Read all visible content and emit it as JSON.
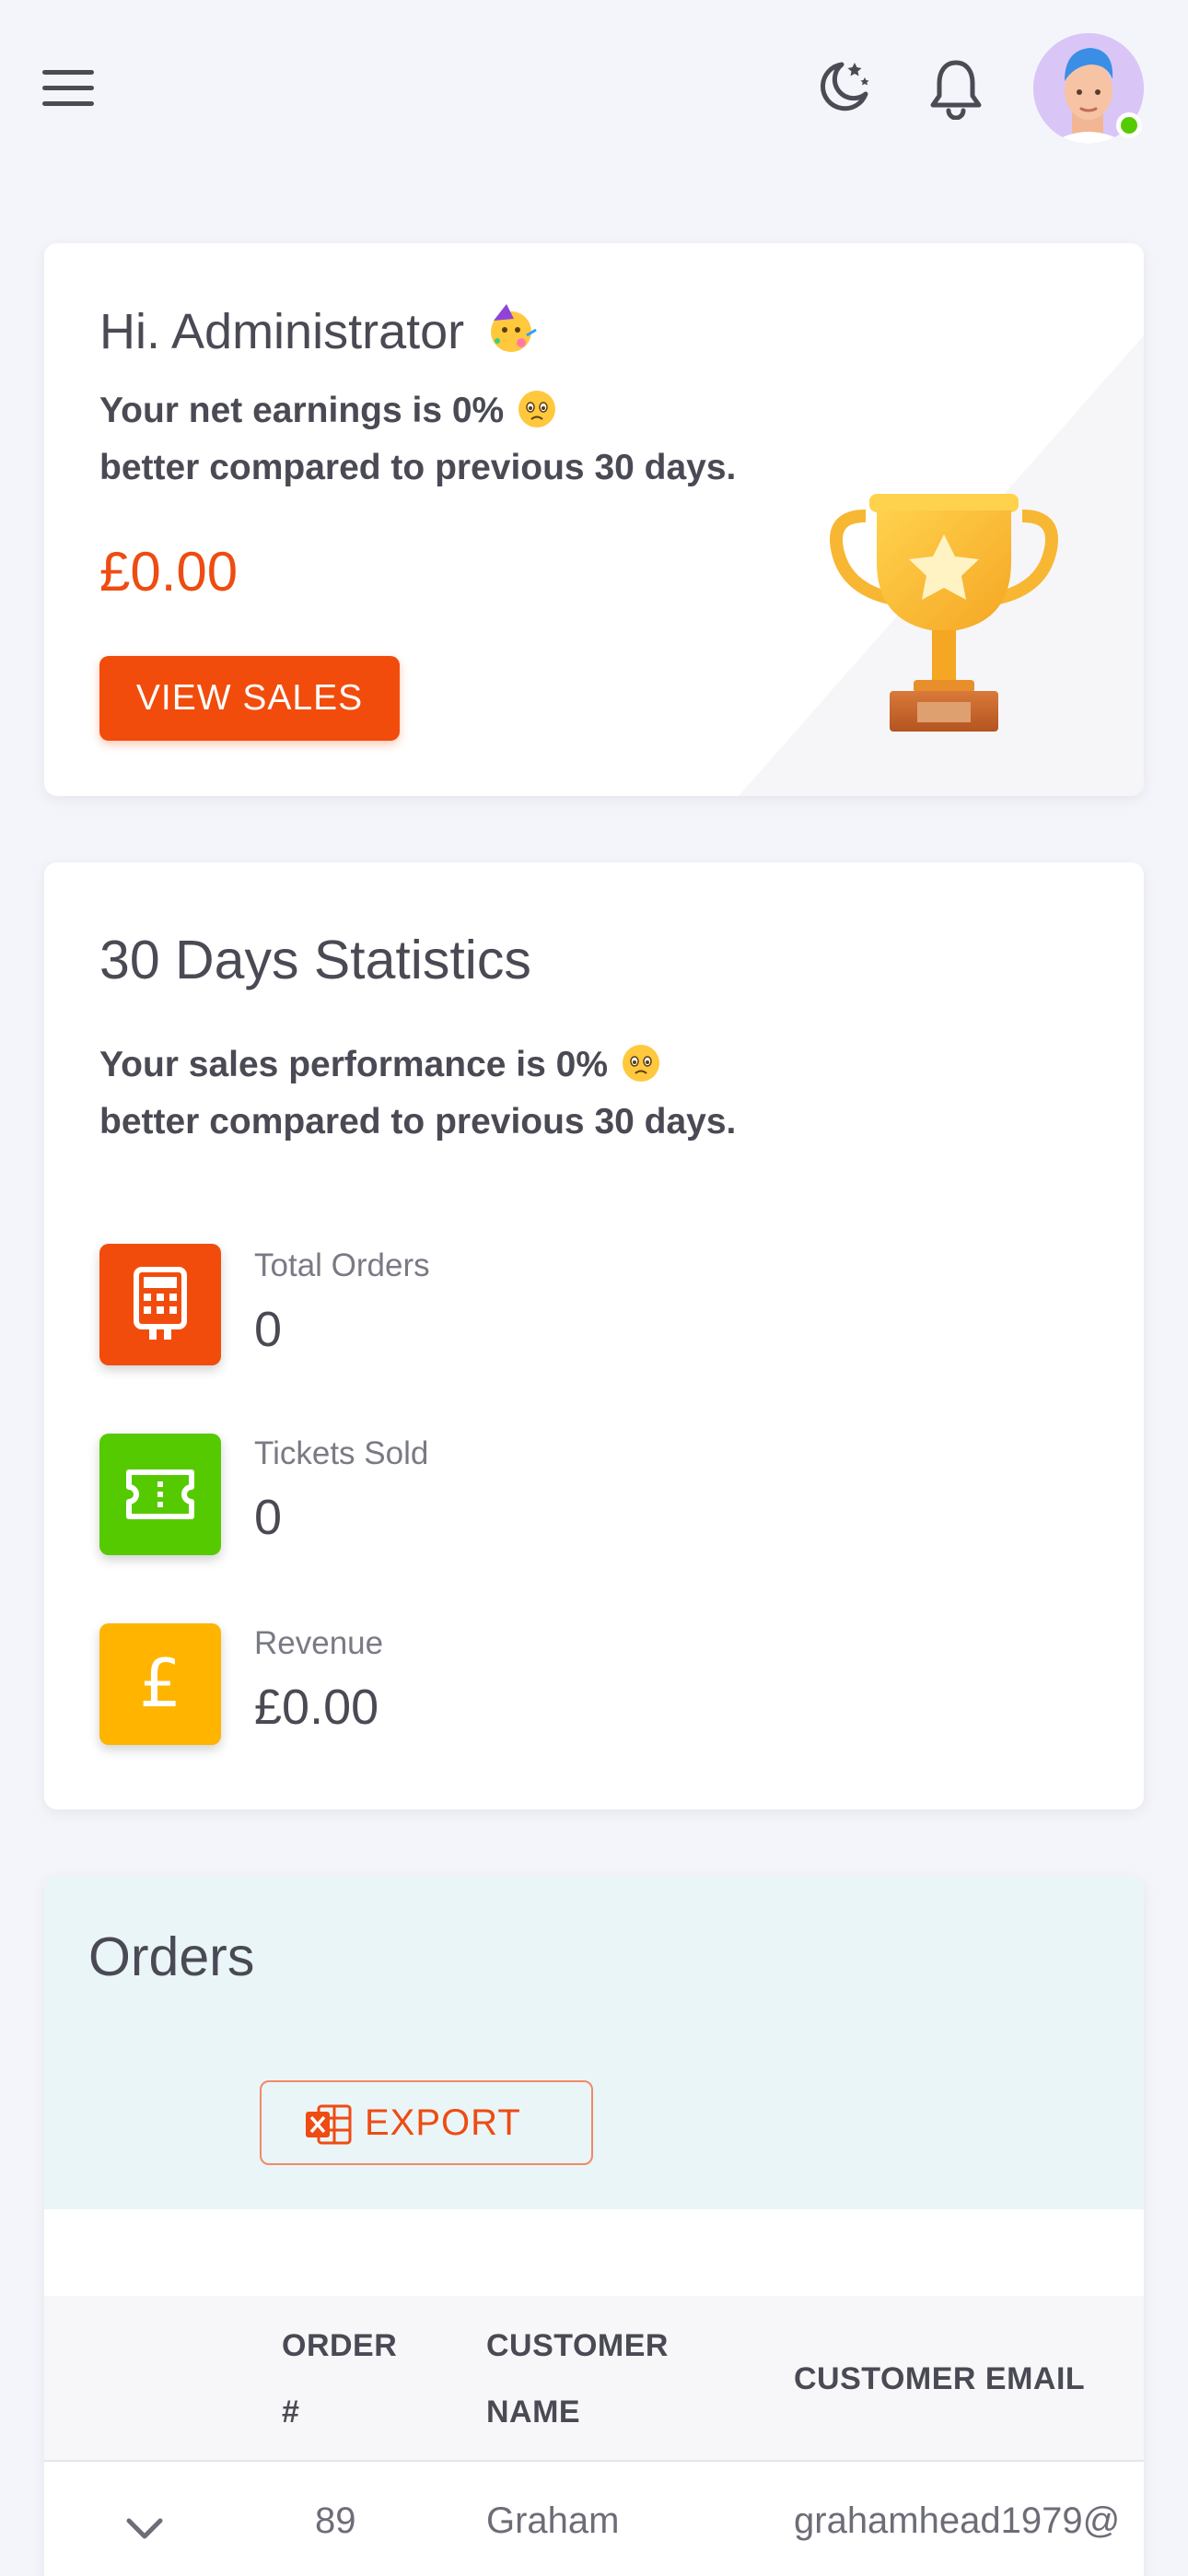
{
  "header": {
    "menu_icon": "hamburger-menu-icon",
    "theme_icon": "moon-stars-icon",
    "notification_icon": "bell-icon",
    "avatar_status_color": "#56ca00"
  },
  "welcome": {
    "greeting": "Hi. Administrator",
    "greeting_emoji": "partying-face",
    "earnings_line1": "Your net earnings is 0%",
    "earnings_line2": "better compared to previous 30 days.",
    "amount": "£0.00",
    "view_sales_label": "VIEW SALES",
    "accent_color": "#f24c0c"
  },
  "stats": {
    "title": "30 Days Statistics",
    "performance_line1": "Your sales performance is 0%",
    "performance_line2": "better compared to previous 30 days.",
    "items": [
      {
        "label": "Total Orders",
        "value": "0",
        "icon": "calculator-icon",
        "color": "#f24c0c"
      },
      {
        "label": "Tickets Sold",
        "value": "0",
        "icon": "ticket-icon",
        "color": "#56ca00"
      },
      {
        "label": "Revenue",
        "value": "£0.00",
        "icon": "pound-icon",
        "color": "#ffb400"
      }
    ]
  },
  "orders": {
    "title": "Orders",
    "export_label": "EXPORT",
    "columns": [
      "ORDER #",
      "CUSTOMER NAME",
      "CUSTOMER EMAIL"
    ],
    "column_order_l1": "ORDER",
    "column_order_l2": "#",
    "column_name_l1": "CUSTOMER",
    "column_name_l2": "NAME",
    "column_email": "CUSTOMER EMAIL",
    "rows": [
      {
        "order": "89",
        "name": "Graham",
        "email": "grahamhead1979@"
      }
    ]
  }
}
